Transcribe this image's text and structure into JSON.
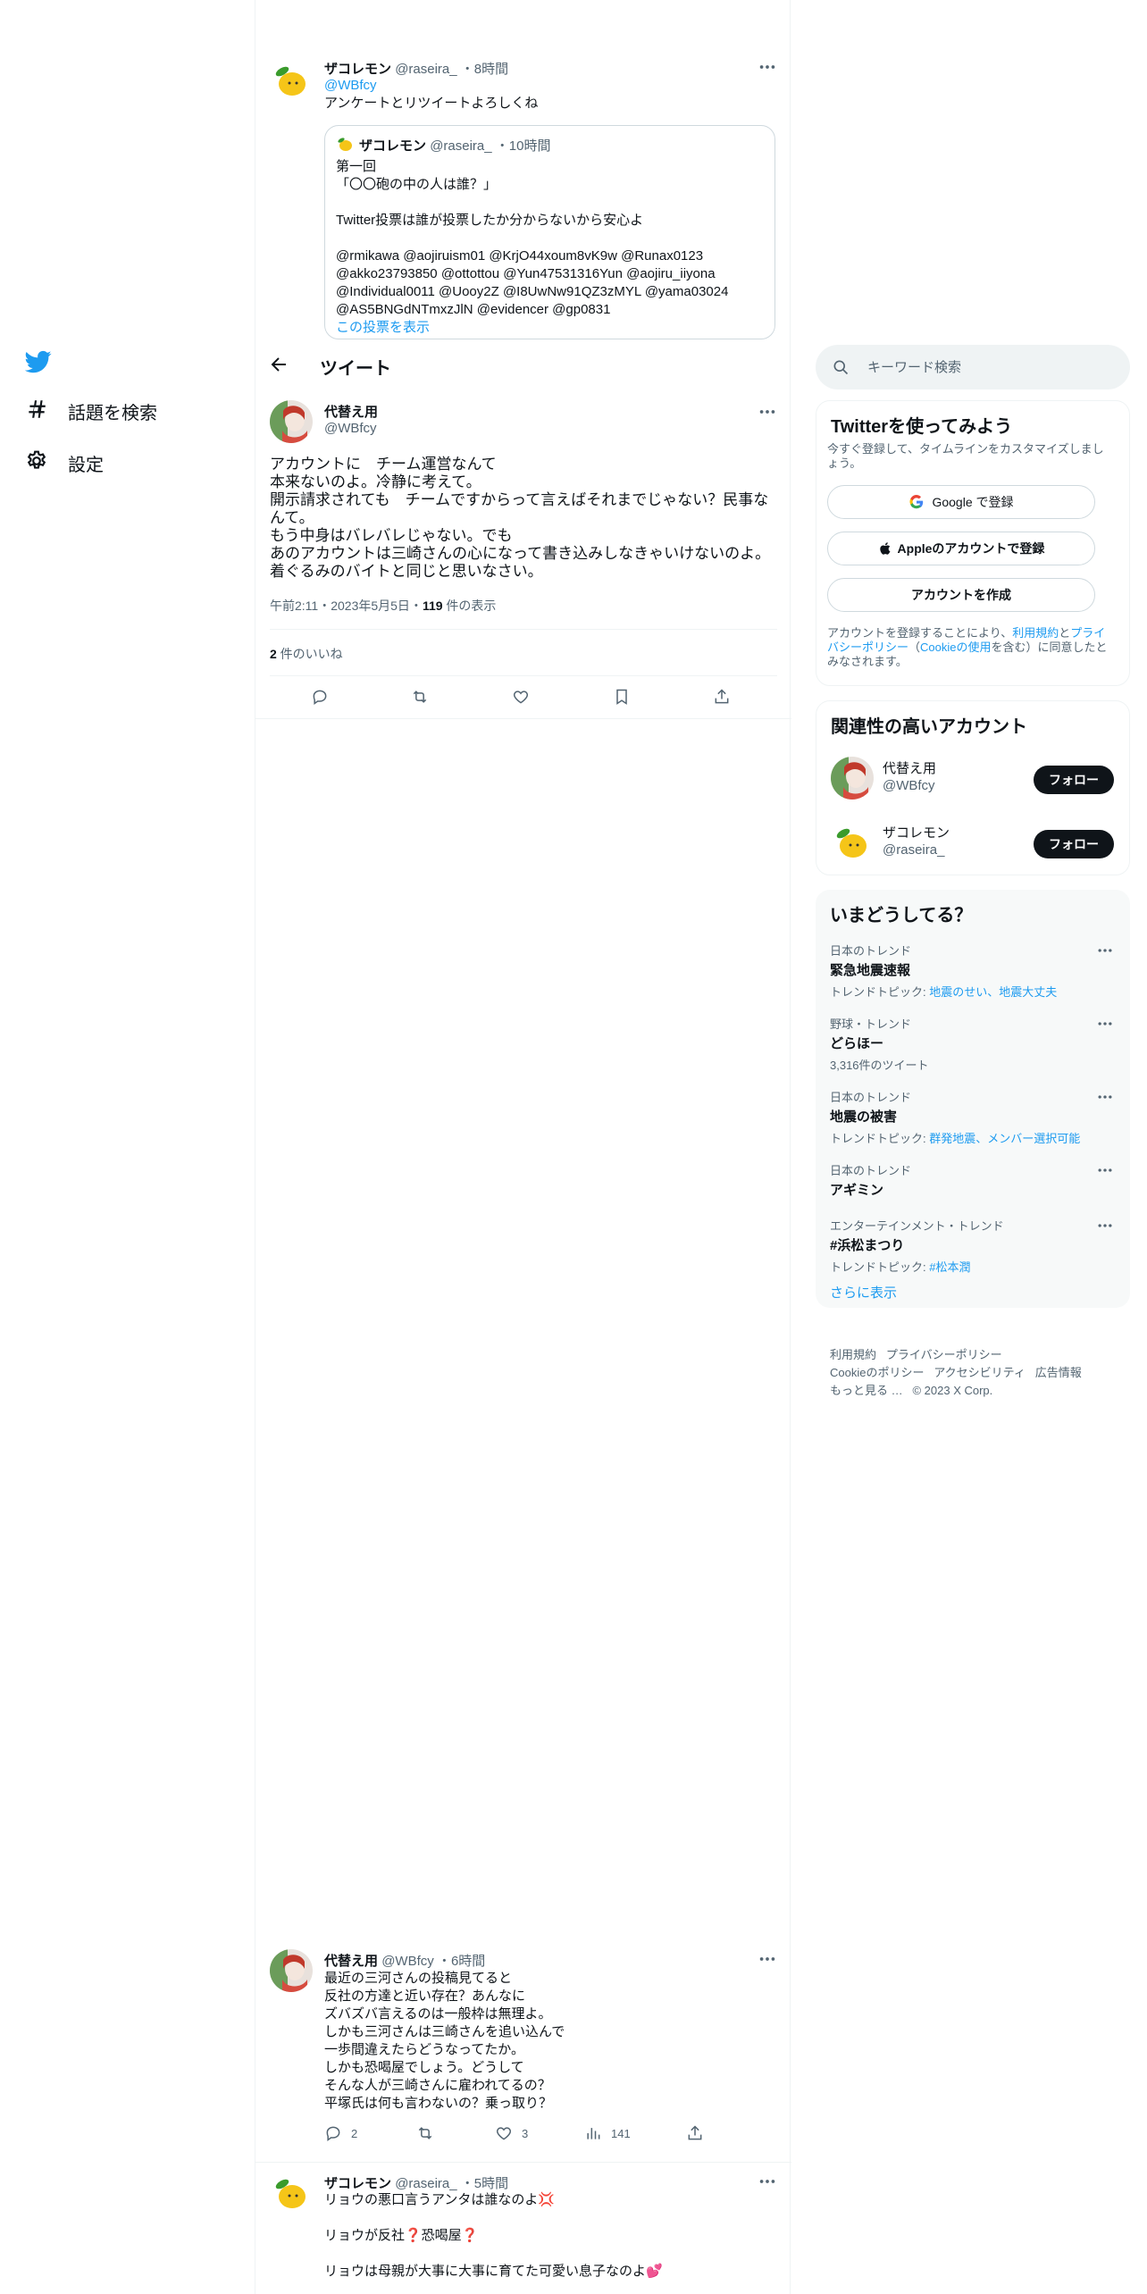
{
  "nav": {
    "explore_label": "話題を検索",
    "settings_label": "設定"
  },
  "header": {
    "title": "ツイート"
  },
  "top_tweet": {
    "name": "ザコレモン",
    "handle": "@raseira_",
    "time": "8時間",
    "reply_to": "@WBfcy",
    "text": "アンケートとリツイートよろしくね",
    "quote": {
      "name": "ザコレモン",
      "handle": "@raseira_",
      "time": "10時間",
      "text": "第一回\n「〇〇砲の中の人は誰？」\n\nTwitter投票は誰が投票したか分からないから安心よ\n\n@rmikawa @aojiruism01 @KrjO44xoum8vK9w @Runax0123\n@akko23793850 @ottottou @Yun47531316Yun @aojiru_iiyona\n@Individual0011 @Uooy2Z @I8UwNw91QZ3zMYL @yama03024\n@AS5BNGdNTmxzJlN @evidencer @gp0831",
      "show_poll": "この投票を表示"
    }
  },
  "main_tweet": {
    "name": "代替え用",
    "handle": "@WBfcy",
    "text": "アカウントに　チーム運営なんて\n本来ないのよ。冷静に考えて。\n開示請求されても　チームですからって言えばそれまでじゃない？民事なんて。\nもう中身はバレバレじゃない。でも\nあのアカウントは三崎さんの心になって書き込みしなきゃいけないのよ。\n着ぐるみのバイトと同じと思いなさい。",
    "timestamp": "午前2:11・2023年5月5日・",
    "views_count": "119",
    "views_label": " 件の表示",
    "likes_count": "2",
    "likes_label": " 件のいいね"
  },
  "reply_1": {
    "name": "代替え用",
    "handle": "@WBfcy",
    "time": "6時間",
    "text": "最近の三河さんの投稿見てると\n反社の方達と近い存在？あんなに\nズバズバ言えるのは一般枠は無理よ。\nしかも三河さんは三崎さんを追い込んで\n一歩間違えたらどうなってたか。\nしかも恐喝屋でしょう。どうして\nそんな人が三崎さんに雇われてるの？\n平塚氏は何も言わないの？乗っ取り？",
    "reply_count": "2",
    "like_count": "3",
    "view_count": "141"
  },
  "reply_2": {
    "name": "ザコレモン",
    "handle": "@raseira_",
    "time": "5時間",
    "line1": "リョウの悪口言うアンタは誰なのよ💢",
    "line2": "リョウが反社❓恐喝屋❓",
    "line3": "リョウは母親が大事に大事に育てた可愛い息子なのよ💕"
  },
  "search": {
    "placeholder": "キーワード検索"
  },
  "signup": {
    "title": "Twitterを使ってみよう",
    "desc": "今すぐ登録して、タイムラインをカスタマイズしましょう。",
    "google_btn": "Google で登録",
    "apple_btn": "Appleのアカウントで登録",
    "create_btn": "アカウントを作成",
    "legal_1": "アカウントを登録することにより、",
    "legal_terms": "利用規約",
    "legal_2": "と",
    "legal_privacy": "プライバシーポリシー",
    "legal_3": "（",
    "legal_cookie": "Cookieの使用",
    "legal_4": "を含む）に同意したとみなされます。"
  },
  "related": {
    "title": "関連性の高いアカウント",
    "accounts": [
      {
        "name": "代替え用",
        "handle": "@WBfcy",
        "button": "フォロー"
      },
      {
        "name": "ザコレモン",
        "handle": "@raseira_",
        "button": "フォロー"
      }
    ]
  },
  "trends": {
    "title": "いまどうしてる？",
    "items": [
      {
        "context": "日本のトレンド",
        "name": "緊急地震速報",
        "sub_prefix": "トレンドトピック: ",
        "sub_links": "地震のせい、地震大丈夫"
      },
      {
        "context": "野球・トレンド",
        "name": "どらほー",
        "sub_prefix": "3,316件のツイート",
        "sub_links": ""
      },
      {
        "context": "日本のトレンド",
        "name": "地震の被害",
        "sub_prefix": "トレンドトピック: ",
        "sub_links": "群発地震、メンバー選択可能"
      },
      {
        "context": "日本のトレンド",
        "name": "アギミン",
        "sub_prefix": "",
        "sub_links": ""
      },
      {
        "context": "エンターテインメント・トレンド",
        "name": "#浜松まつり",
        "sub_prefix": "トレンドトピック: ",
        "sub_links": "#松本潤"
      }
    ],
    "show_more": "さらに表示"
  },
  "footer": {
    "terms": "利用規約",
    "privacy": "プライバシーポリシー",
    "cookie": "Cookieのポリシー",
    "accessibility": "アクセシビリティ",
    "ads": "広告情報",
    "more": "もっと見る …",
    "copyright": "© 2023 X Corp."
  },
  "colors": {
    "accent": "#1d9bf0",
    "text": "#0f1419",
    "secondary": "#536471",
    "border": "#eff3f4"
  }
}
